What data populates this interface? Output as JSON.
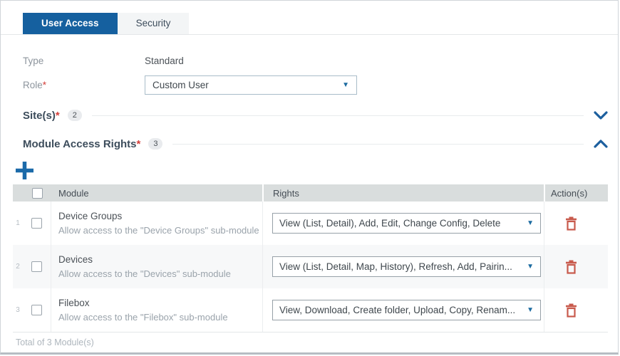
{
  "tabs": {
    "user_access": "User Access",
    "security": "Security"
  },
  "form": {
    "type": {
      "label": "Type",
      "value": "Standard"
    },
    "role": {
      "label": "Role",
      "value": "Custom User"
    }
  },
  "misc": {
    "asterisk": "*",
    "dropdown_arrow": "▼"
  },
  "sections": {
    "sites": {
      "title": "Site(s)",
      "count": "2",
      "state": "collapsed"
    },
    "modules": {
      "title": "Module Access Rights",
      "count": "3",
      "state": "expanded"
    }
  },
  "table": {
    "headers": {
      "module": "Module",
      "rights": "Rights",
      "actions": "Action(s)"
    },
    "rows": [
      {
        "index": "1",
        "name": "Device Groups",
        "description": "Allow access to the \"Device Groups\" sub-module",
        "rights": "View (List, Detail), Add, Edit, Change Config, Delete"
      },
      {
        "index": "2",
        "name": "Devices",
        "description": "Allow access to the \"Devices\" sub-module",
        "rights": "View (List, Detail, Map, History), Refresh, Add, Pairin..."
      },
      {
        "index": "3",
        "name": "Filebox",
        "description": "Allow access to the \"Filebox\" sub-module",
        "rights": "View, Download, Create folder, Upload, Copy, Renam..."
      }
    ],
    "footer": "Total of 3 Module(s)"
  },
  "colors": {
    "accent_blue": "#15609f",
    "icon_blue": "#1b6aa9",
    "danger_red": "#c85a4c",
    "asterisk_red": "#d43f3a"
  }
}
